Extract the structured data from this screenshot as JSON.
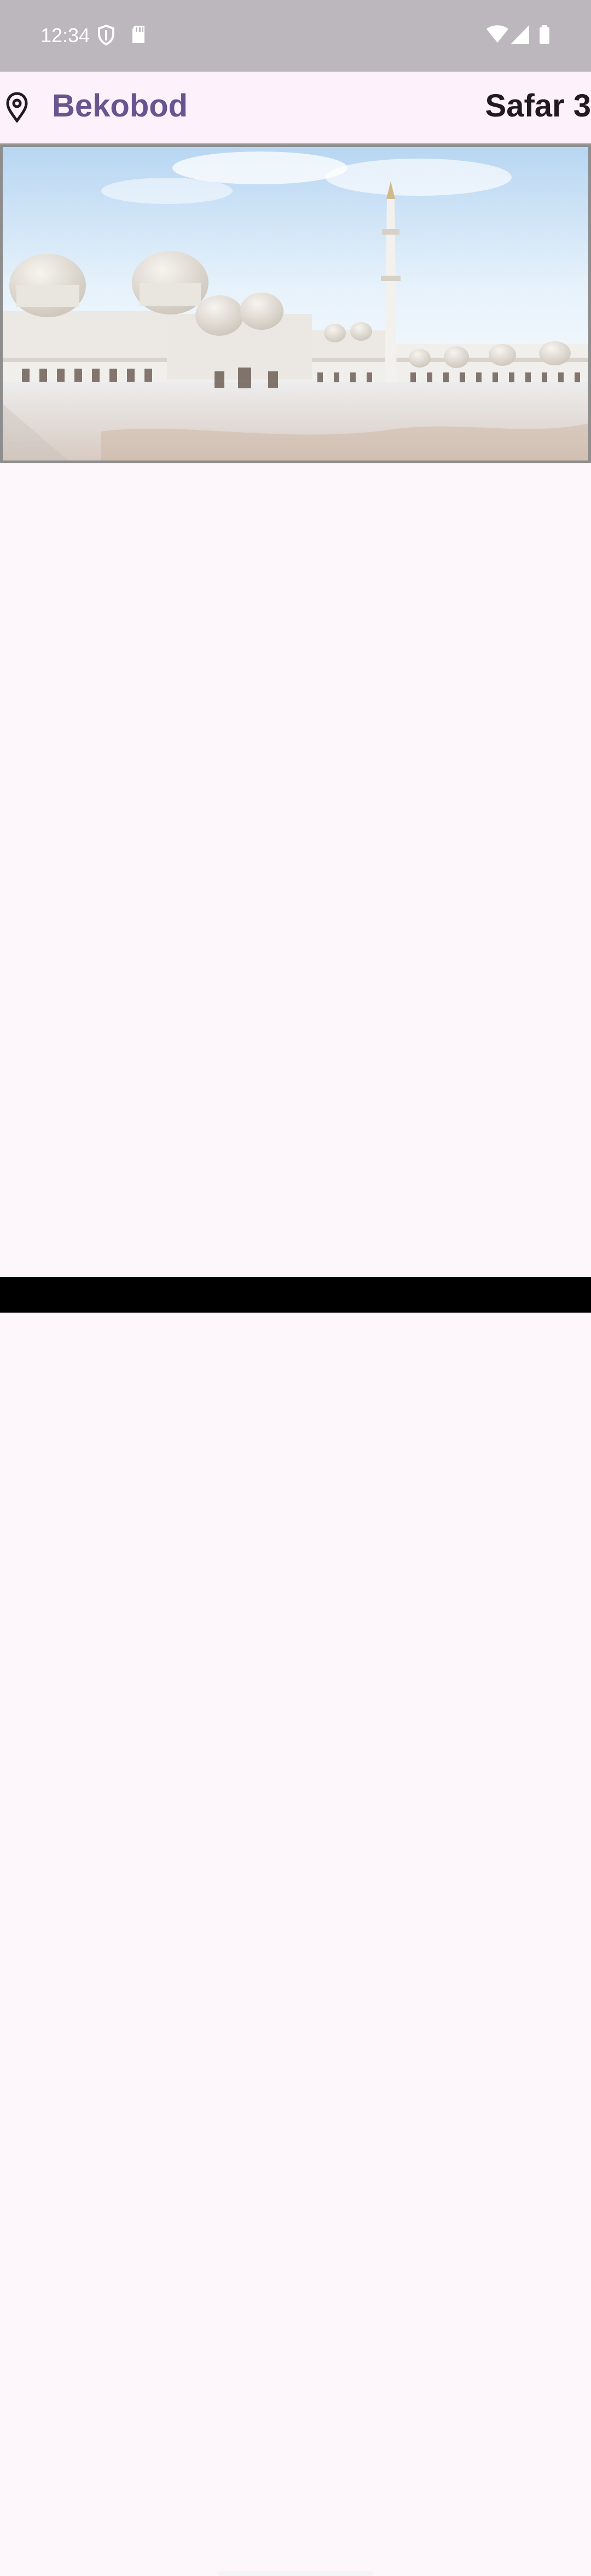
{
  "status_bar": {
    "time": "12:34",
    "icons": [
      "shield-icon",
      "sd-card-icon",
      "wifi-icon",
      "signal-icon",
      "battery-icon"
    ],
    "background": "#bbb7bc"
  },
  "app_bar": {
    "location_icon": "location-pin-icon",
    "city": "Bekobod",
    "hijri_date": "Safar 3",
    "accent_color": "#66558f"
  },
  "hero": {
    "image": "mosque-photo"
  },
  "navigation": {
    "home_indicator": "home-indicator"
  }
}
